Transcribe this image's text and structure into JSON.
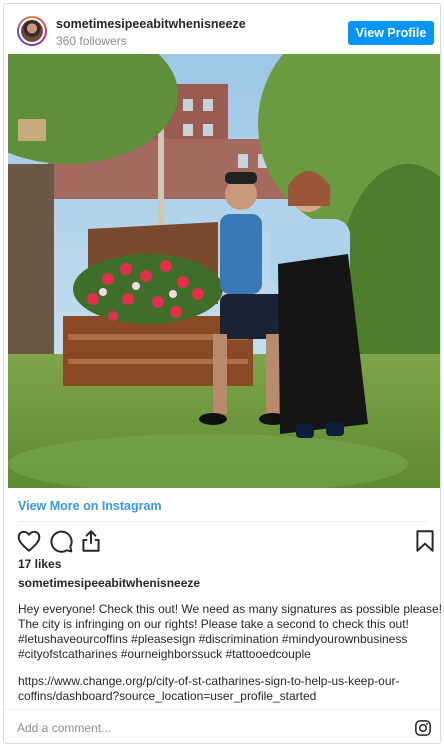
{
  "header": {
    "username": "sometimesipeeabitwhenisneeze",
    "followers": "360 followers",
    "view_profile_label": "View Profile"
  },
  "post": {
    "view_more_label": "View More on Instagram",
    "likes": "17 likes",
    "caption_username": "sometimesipeeabitwhenisneeze",
    "caption_lines": [
      "Hey everyone! Check this out! We need as many signatures as possible please!",
      "The city is infringing on our rights! Please take a second to check this out!",
      "#letushaveourcoffins #pleasesign #discrimination #mindyourownbusiness",
      "#cityofstcatharines #ourneighborssuck #tattooedcouple"
    ],
    "url_lines": [
      "https://www.change.org/p/city-of-st-catharines-sign-to-help-us-keep-our-",
      "coffins/dashboard?source_location=user_profile_started"
    ]
  },
  "comment": {
    "placeholder": "Add a comment..."
  },
  "icons": {
    "like": "heart-icon",
    "comment": "comment-icon",
    "share": "share-icon",
    "save": "bookmark-icon",
    "instagram": "instagram-logo-icon"
  },
  "colors": {
    "accent": "#0095f6",
    "link": "#3897f0",
    "muted": "#8e8e8e",
    "text": "#262626"
  }
}
